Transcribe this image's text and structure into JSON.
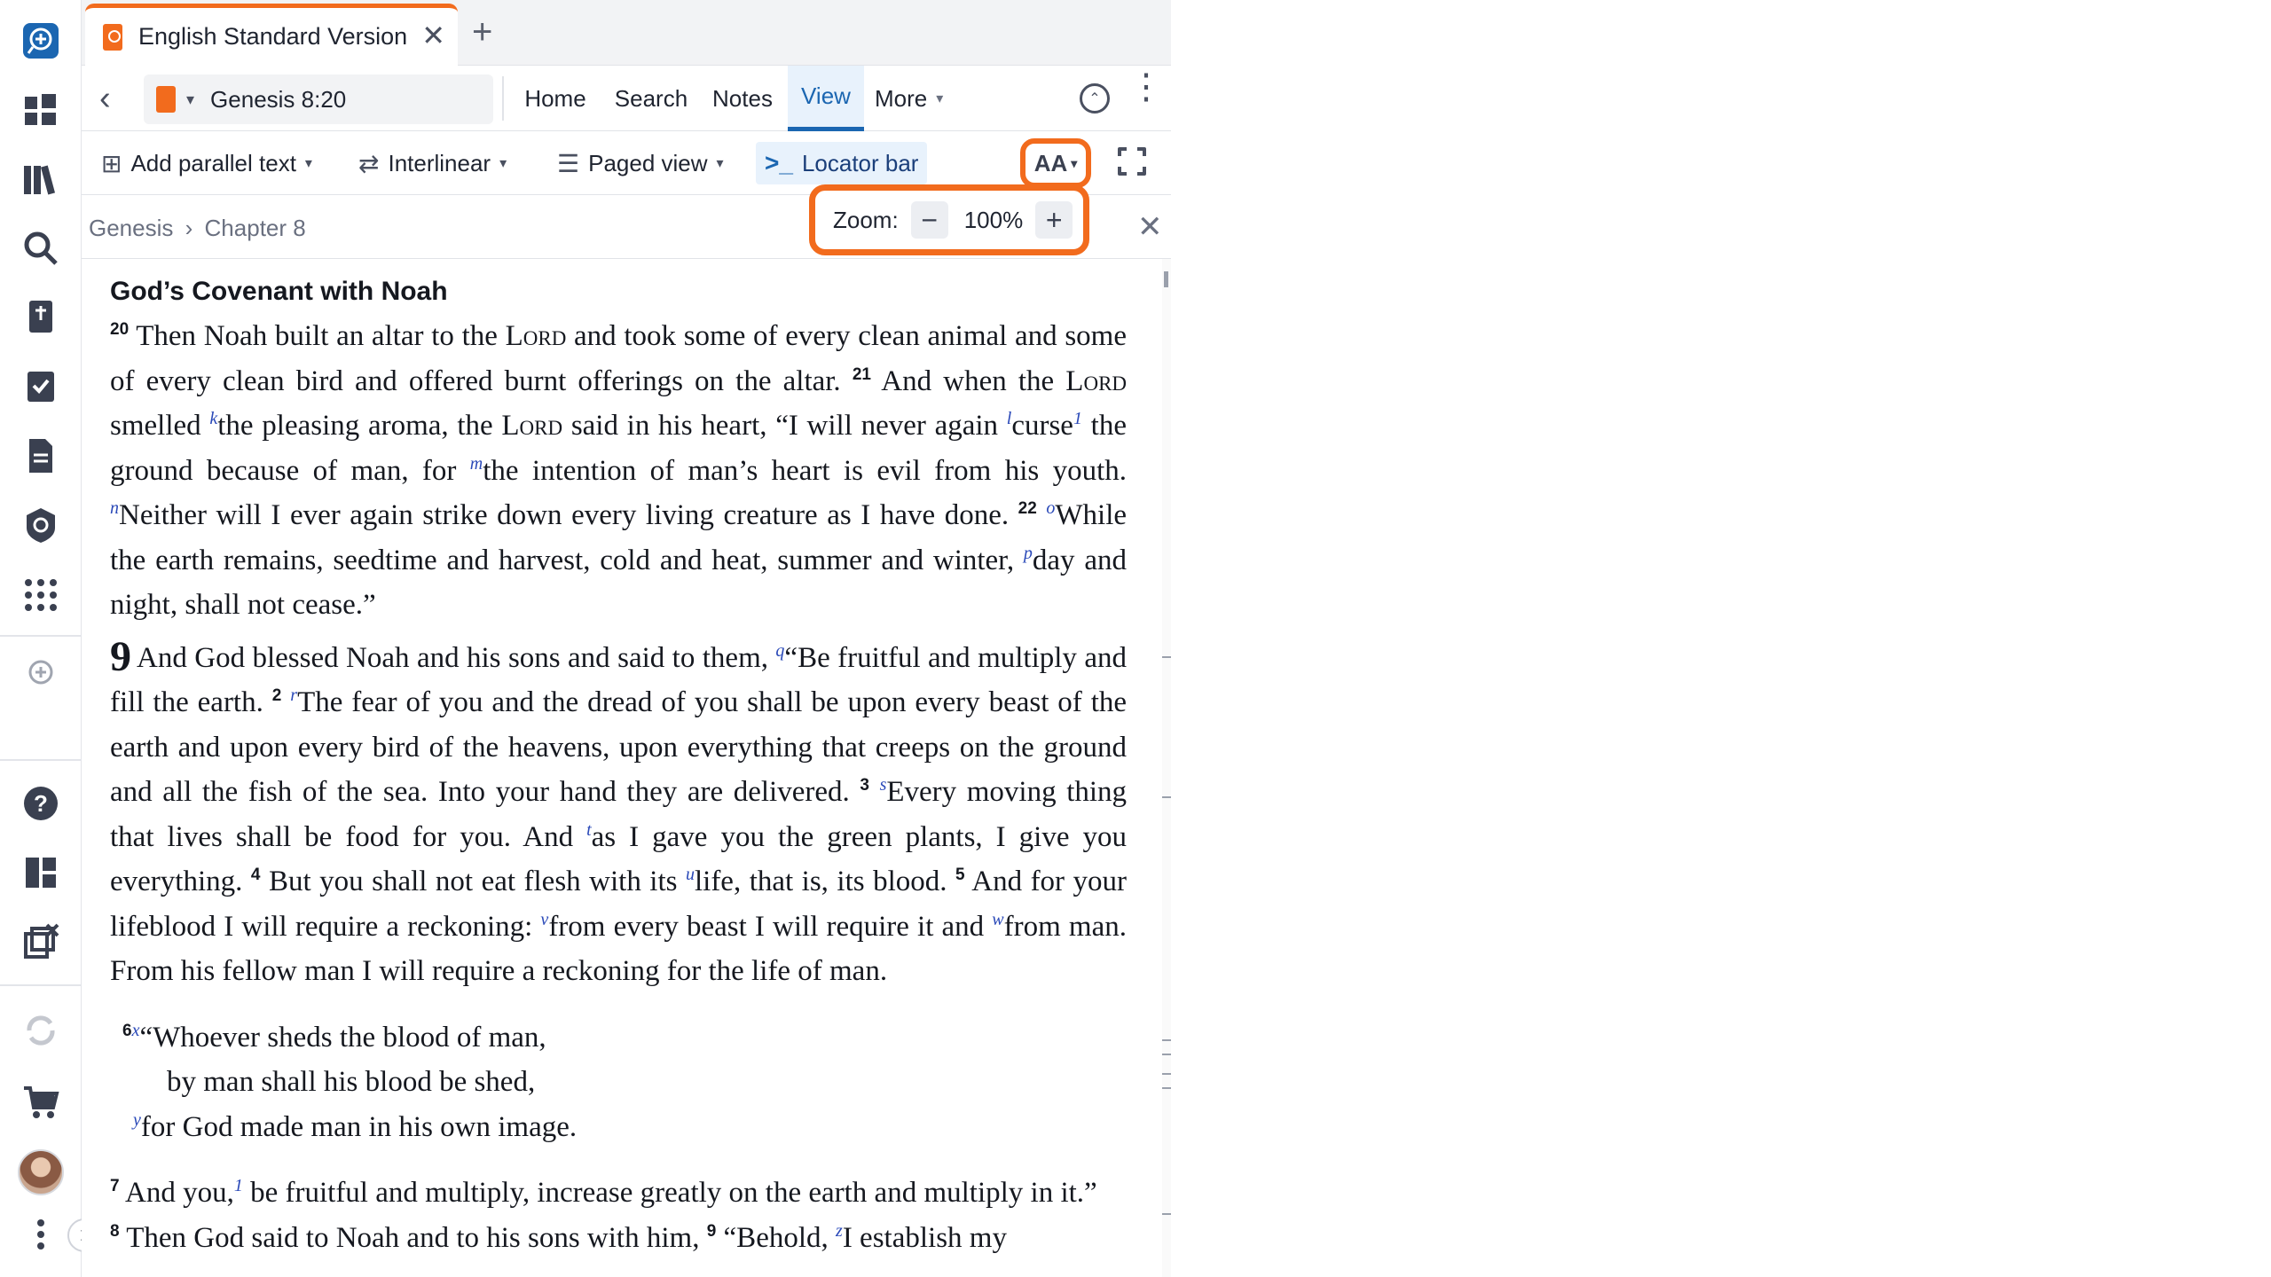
{
  "tab": {
    "title": "English Standard Version",
    "close": "✕",
    "add": "+"
  },
  "nav": {
    "reference": "Genesis 8:20",
    "menus": [
      "Home",
      "Search",
      "Notes",
      "View",
      "More"
    ]
  },
  "toolbar": {
    "add_parallel": "Add parallel text",
    "interlinear": "Interlinear",
    "paged_view": "Paged view",
    "locator_bar": "Locator bar",
    "font_button": "AA"
  },
  "locator": {
    "book": "Genesis",
    "sep": "›",
    "chapter": "Chapter 8",
    "close": "✕"
  },
  "zoom": {
    "label": "Zoom:",
    "value": "100%",
    "minus": "−",
    "plus": "+"
  },
  "text": {
    "heading": "God’s Covenant with Noah",
    "v20": "20",
    "v20_text_a": "Then Noah built an altar to the ",
    "lord": "Lord",
    "v20_text_b": " and took some of every clean animal and some of every clean bird and offered burnt offerings on the altar.",
    "v21": "21",
    "v21_text_a": "And when the ",
    "v21_text_b": " smelled ",
    "fn_k": "k",
    "v21_text_c": "the pleasing aroma, the ",
    "v21_text_d": " said in his heart, “I will never again ",
    "fn_l": "l",
    "v21_text_e": "curse",
    "fn_1": "1",
    "v21_text_f": " the ground because of man, for ",
    "fn_m": "m",
    "v21_text_g": "the intention of man’s heart is evil from his youth. ",
    "fn_n": "n",
    "v21_text_h": "Neither will I ever again strike down every living creature as I have done.",
    "v22": "22",
    "fn_o": "o",
    "v22_text_a": "While the earth remains, seedtime and harvest, cold and heat, summer and winter, ",
    "fn_p": "p",
    "v22_text_b": "day and night, shall not cease.”",
    "ch9": "9",
    "c9v1_text_a": "And God blessed Noah and his sons and said to them, ",
    "fn_q": "q",
    "c9v1_text_b": "“Be fruitful and multiply and fill the earth.",
    "c9v2": "2",
    "fn_r": "r",
    "c9v2_text": "The fear of you and the dread of you shall be upon every beast of the earth and upon every bird of the heavens, upon everything that creeps on the ground and all the fish of the sea. Into your hand they are delivered.",
    "c9v3": "3",
    "fn_s": "s",
    "c9v3_text_a": "Every moving thing that lives shall be food for you. And ",
    "fn_t": "t",
    "c9v3_text_b": "as I gave you the green plants, I give you everything.",
    "c9v4": "4",
    "c9v4_text_a": "But you shall not eat flesh with its ",
    "fn_u": "u",
    "c9v4_text_b": "life, that is, its blood.",
    "c9v5": "5",
    "c9v5_text_a": "And for your lifeblood I will require a reckoning: ",
    "fn_v": "v",
    "c9v5_text_b": "from every beast I will require it and ",
    "fn_w": "w",
    "c9v5_text_c": "from man. From his fellow man I will require a reckoning for the life of man.",
    "c9v6": "6",
    "fn_x": "x",
    "poem_1": "“Whoever sheds the blood of man,",
    "poem_2": "by man shall his blood be shed,",
    "fn_y": "y",
    "poem_3": "for God made man in his own image.",
    "c9v7": "7",
    "c9v7_text_a": "And you,",
    "c9v7_text_b": " be fruitful and multiply, increase greatly on the earth and multiply in it.”",
    "c9v8": "8",
    "c9v8_text_a": "Then God said to Noah and to his sons with him,",
    "c9v9": "9",
    "c9v9_text_a": "“Behold, ",
    "fn_z": "z",
    "c9v9_text_b": "I establish my"
  },
  "colors": {
    "accent": "#f26b1d",
    "active": "#1b66b1",
    "footnote": "#2a49b8"
  }
}
